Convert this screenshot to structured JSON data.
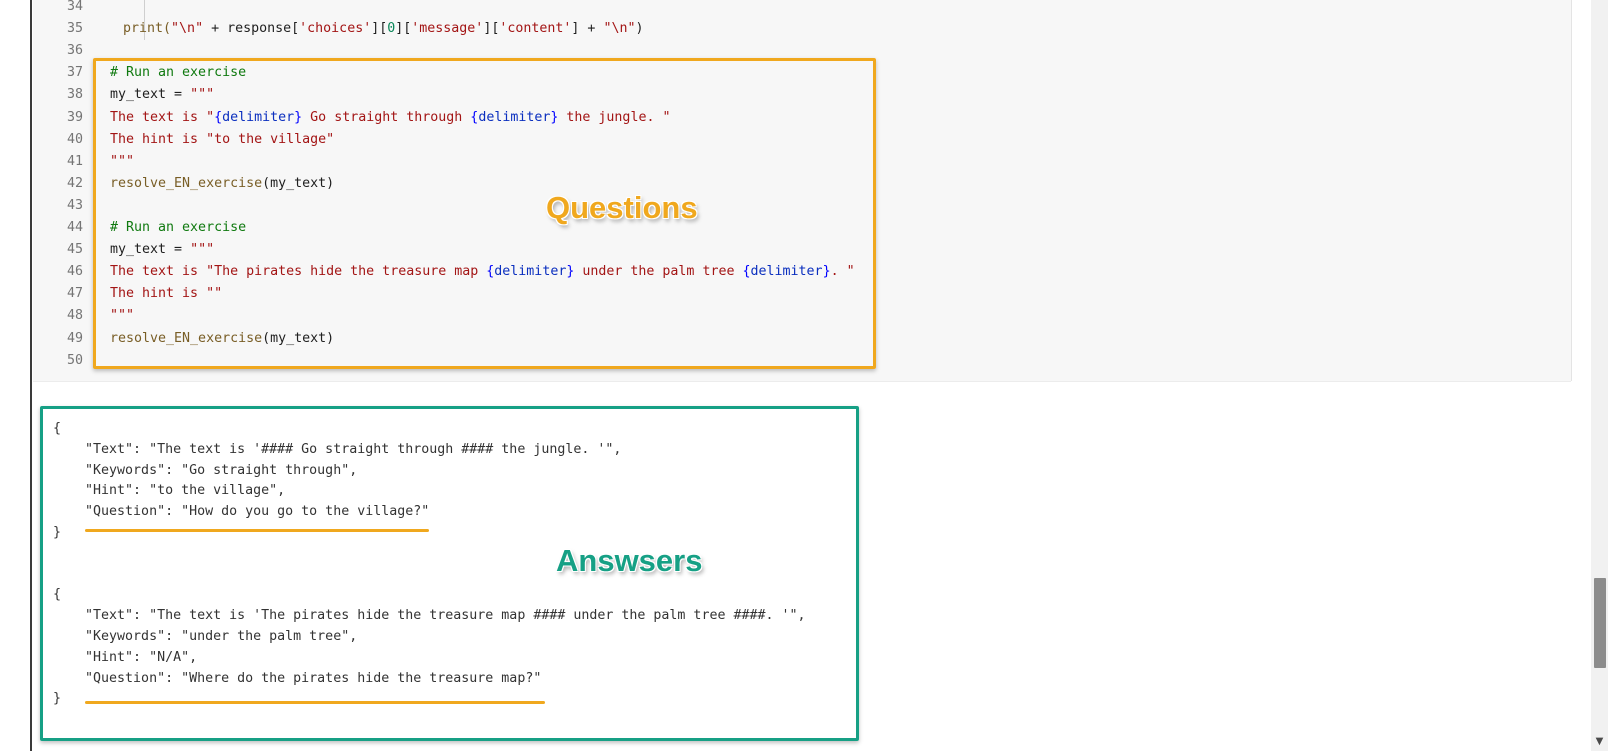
{
  "code_cell": {
    "lines": [
      {
        "num": "34",
        "segments": []
      },
      {
        "num": "35",
        "segments": [
          {
            "t": "print(",
            "c": "c-fn"
          },
          {
            "t": "\"\\n\"",
            "c": "c-str"
          },
          {
            "t": " + response[",
            "c": "c-var"
          },
          {
            "t": "'choices'",
            "c": "c-str"
          },
          {
            "t": "][",
            "c": "c-var"
          },
          {
            "t": "0",
            "c": "c-num"
          },
          {
            "t": "][",
            "c": "c-var"
          },
          {
            "t": "'message'",
            "c": "c-str"
          },
          {
            "t": "][",
            "c": "c-var"
          },
          {
            "t": "'content'",
            "c": "c-str"
          },
          {
            "t": "] + ",
            "c": "c-var"
          },
          {
            "t": "\"\\n\"",
            "c": "c-str"
          },
          {
            "t": ")",
            "c": "c-var"
          }
        ]
      },
      {
        "num": "36",
        "segments": []
      },
      {
        "num": "37",
        "segments": [
          {
            "t": "# Run an exercise",
            "c": "c-comment"
          }
        ]
      },
      {
        "num": "38",
        "segments": [
          {
            "t": "my_text = ",
            "c": "c-var"
          },
          {
            "t": "\"\"\"",
            "c": "c-str"
          }
        ]
      },
      {
        "num": "39",
        "segments": [
          {
            "t": "The text is \"",
            "c": "c-str"
          },
          {
            "t": "{",
            "c": "c-brace"
          },
          {
            "t": "delimiter",
            "c": "c-del"
          },
          {
            "t": "}",
            "c": "c-brace"
          },
          {
            "t": " Go straight through ",
            "c": "c-str"
          },
          {
            "t": "{",
            "c": "c-brace"
          },
          {
            "t": "delimiter",
            "c": "c-del"
          },
          {
            "t": "}",
            "c": "c-brace"
          },
          {
            "t": " the jungle. \"",
            "c": "c-str"
          }
        ]
      },
      {
        "num": "40",
        "segments": [
          {
            "t": "The hint is \"to the village\"",
            "c": "c-str"
          }
        ]
      },
      {
        "num": "41",
        "segments": [
          {
            "t": "\"\"\"",
            "c": "c-str"
          }
        ]
      },
      {
        "num": "42",
        "segments": [
          {
            "t": "resolve_EN_exercise",
            "c": "c-fn"
          },
          {
            "t": "(my_text)",
            "c": "c-var"
          }
        ]
      },
      {
        "num": "43",
        "segments": []
      },
      {
        "num": "44",
        "segments": [
          {
            "t": "# Run an exercise",
            "c": "c-comment"
          }
        ]
      },
      {
        "num": "45",
        "segments": [
          {
            "t": "my_text = ",
            "c": "c-var"
          },
          {
            "t": "\"\"\"",
            "c": "c-str"
          }
        ]
      },
      {
        "num": "46",
        "segments": [
          {
            "t": "The text is \"The pirates hide the treasure map ",
            "c": "c-str"
          },
          {
            "t": "{",
            "c": "c-brace"
          },
          {
            "t": "delimiter",
            "c": "c-del"
          },
          {
            "t": "}",
            "c": "c-brace"
          },
          {
            "t": " under the palm tree ",
            "c": "c-str"
          },
          {
            "t": "{",
            "c": "c-brace"
          },
          {
            "t": "delimiter",
            "c": "c-del"
          },
          {
            "t": "}",
            "c": "c-brace"
          },
          {
            "t": ". \"",
            "c": "c-str"
          }
        ]
      },
      {
        "num": "47",
        "segments": [
          {
            "t": "The hint is \"\"",
            "c": "c-str"
          }
        ]
      },
      {
        "num": "48",
        "segments": [
          {
            "t": "\"\"\"",
            "c": "c-str"
          }
        ]
      },
      {
        "num": "49",
        "segments": [
          {
            "t": "resolve_EN_exercise",
            "c": "c-fn"
          },
          {
            "t": "(my_text)",
            "c": "c-var"
          }
        ]
      },
      {
        "num": "50",
        "segments": []
      }
    ]
  },
  "output": {
    "lines": [
      "{",
      "    \"Text\": \"The text is '#### Go straight through #### the jungle. '\",",
      "    \"Keywords\": \"Go straight through\",",
      "    \"Hint\": \"to the village\",",
      "    \"Question\": \"How do you go to the village?\"",
      "}",
      "",
      "",
      "{",
      "    \"Text\": \"The text is 'The pirates hide the treasure map #### under the palm tree ####. '\",",
      "    \"Keywords\": \"under the palm tree\",",
      "    \"Hint\": \"N/A\",",
      "    \"Question\": \"Where do the pirates hide the treasure map?\"",
      "}"
    ]
  },
  "annotations": {
    "questions_label": "Questions",
    "answers_label": "Answsers",
    "questions_color": "#f0a81e",
    "answers_color": "#16a085"
  },
  "scrollbar": {
    "down_arrow_icon": "chevron-down-icon",
    "down_arrow_glyph": "▼"
  }
}
